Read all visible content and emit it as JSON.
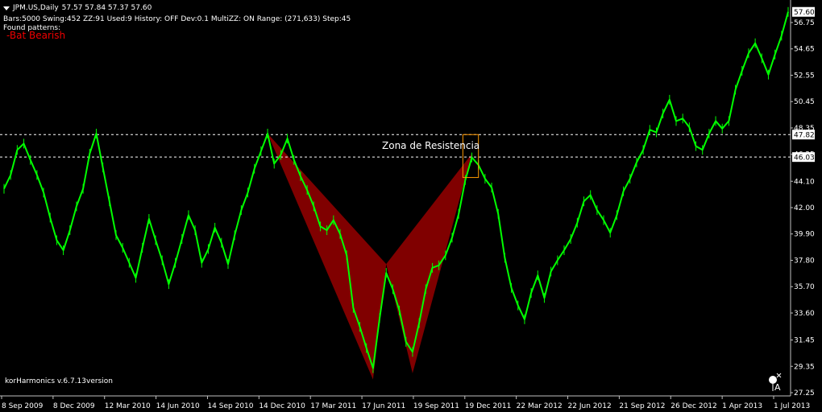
{
  "header": {
    "symbol": "JPM.US,Daily",
    "ohlc": "57.57 57.84 57.37 57.60",
    "info": "Bars:5000  Swing:452  ZZ:91  Used:9  History: OFF Dev:0.1  MultiZZ: ON  Range: (271,633)  Step:45",
    "found_label": "Found patterns:",
    "pattern": "-Bat Bearish"
  },
  "version_label": "korHarmonics v.6.7.13version",
  "colors": {
    "price": "#00ff00",
    "pattern_fill": "#800000",
    "zone_box": "#ff9900",
    "last_price_bg": "#ffffff"
  },
  "chart_data": {
    "type": "line",
    "series": [
      {
        "values": [
          [
            0,
            43.5
          ],
          [
            1,
            44.6
          ],
          [
            2,
            46.6
          ],
          [
            3,
            47.1
          ],
          [
            4,
            45.8
          ],
          [
            5,
            44.6
          ],
          [
            6,
            43.2
          ],
          [
            7,
            41.2
          ],
          [
            8,
            39.4
          ],
          [
            9,
            38.6
          ],
          [
            10,
            40.2
          ],
          [
            11,
            42.1
          ],
          [
            12,
            43.5
          ],
          [
            13,
            46.3
          ],
          [
            14,
            47.9
          ],
          [
            15,
            45.2
          ],
          [
            16,
            42.5
          ],
          [
            17,
            39.8
          ],
          [
            18,
            38.8
          ],
          [
            19,
            37.6
          ],
          [
            20,
            36.4
          ],
          [
            21,
            38.8
          ],
          [
            22,
            41.1
          ],
          [
            23,
            39.4
          ],
          [
            24,
            37.8
          ],
          [
            25,
            35.9
          ],
          [
            26,
            37.6
          ],
          [
            27,
            39.5
          ],
          [
            28,
            41.4
          ],
          [
            29,
            40.2
          ],
          [
            30,
            37.6
          ],
          [
            31,
            38.7
          ],
          [
            32,
            40.4
          ],
          [
            33,
            39.2
          ],
          [
            34,
            37.5
          ],
          [
            35,
            39.8
          ],
          [
            36,
            41.8
          ],
          [
            37,
            43.2
          ],
          [
            38,
            45.1
          ],
          [
            39,
            46.5
          ],
          [
            40,
            47.9
          ],
          [
            41,
            45.5
          ],
          [
            42,
            46.2
          ],
          [
            43,
            47.5
          ],
          [
            44,
            45.8
          ],
          [
            45,
            44.5
          ],
          [
            46,
            43.4
          ],
          [
            47,
            42.1
          ],
          [
            48,
            40.5
          ],
          [
            49,
            40.2
          ],
          [
            50,
            41.0
          ],
          [
            51,
            39.9
          ],
          [
            52,
            38.2
          ],
          [
            53,
            34.0
          ],
          [
            54,
            32.5
          ],
          [
            55,
            30.8
          ],
          [
            56,
            29.2
          ],
          [
            57,
            33.2
          ],
          [
            58,
            36.8
          ],
          [
            59,
            35.5
          ],
          [
            60,
            33.8
          ],
          [
            61,
            31.3
          ],
          [
            62,
            30.5
          ],
          [
            63,
            32.8
          ],
          [
            64,
            35.5
          ],
          [
            65,
            37.2
          ],
          [
            66,
            37.4
          ],
          [
            67,
            38.2
          ],
          [
            68,
            39.6
          ],
          [
            69,
            41.5
          ],
          [
            70,
            44.2
          ],
          [
            71,
            46.0
          ],
          [
            72,
            45.4
          ],
          [
            73,
            44.3
          ],
          [
            74,
            43.6
          ],
          [
            75,
            41.5
          ],
          [
            76,
            38.0
          ],
          [
            77,
            35.6
          ],
          [
            78,
            34.2
          ],
          [
            79,
            33.1
          ],
          [
            80,
            35.2
          ],
          [
            81,
            36.6
          ],
          [
            82,
            34.8
          ],
          [
            83,
            36.9
          ],
          [
            84,
            37.8
          ],
          [
            85,
            38.6
          ],
          [
            86,
            39.5
          ],
          [
            87,
            40.8
          ],
          [
            88,
            42.5
          ],
          [
            89,
            43.0
          ],
          [
            90,
            41.8
          ],
          [
            91,
            41.0
          ],
          [
            92,
            40.0
          ],
          [
            93,
            41.4
          ],
          [
            94,
            43.3
          ],
          [
            95,
            44.3
          ],
          [
            96,
            45.6
          ],
          [
            97,
            46.6
          ],
          [
            98,
            48.2
          ],
          [
            99,
            48.0
          ],
          [
            100,
            49.5
          ],
          [
            101,
            50.6
          ],
          [
            102,
            48.9
          ],
          [
            103,
            49.1
          ],
          [
            104,
            48.4
          ],
          [
            105,
            46.9
          ],
          [
            106,
            46.6
          ],
          [
            107,
            47.9
          ],
          [
            108,
            48.9
          ],
          [
            109,
            48.3
          ],
          [
            110,
            48.9
          ],
          [
            111,
            51.4
          ],
          [
            112,
            52.9
          ],
          [
            113,
            54.3
          ],
          [
            114,
            55.1
          ],
          [
            115,
            53.9
          ],
          [
            116,
            52.6
          ],
          [
            117,
            54.2
          ],
          [
            118,
            55.7
          ],
          [
            119,
            57.6
          ]
        ]
      }
    ],
    "x_ticks": [
      "8 Sep 2009",
      "8 Dec 2009",
      "12 Mar 2010",
      "14 Jun 2010",
      "14 Sep 2010",
      "14 Dec 2010",
      "17 Mar 2011",
      "17 Jun 2011",
      "19 Sep 2011",
      "19 Dec 2011",
      "22 Mar 2012",
      "22 Jun 2012",
      "21 Sep 2012",
      "26 Dec 2012",
      "1 Apr 2013",
      "1 Jul 2013"
    ],
    "y_ticks": [
      "56.75",
      "54.65",
      "52.55",
      "50.45",
      "48.35",
      "46.25",
      "44.10",
      "42.00",
      "39.90",
      "37.80",
      "35.70",
      "33.60",
      "31.45",
      "29.35",
      "27.25"
    ],
    "y_tick_values": [
      56.75,
      54.65,
      52.55,
      50.45,
      48.35,
      46.25,
      44.1,
      42.0,
      39.9,
      37.8,
      35.7,
      33.6,
      31.45,
      29.35,
      27.25
    ],
    "ylim": [
      27.25,
      56.75
    ],
    "last_price": {
      "label": "57.60",
      "value": 57.6
    },
    "levels": [
      {
        "label": "47.82",
        "value": 47.82
      },
      {
        "label": "46.03",
        "value": 46.03
      }
    ],
    "zone_label": "Zona de Resistencia",
    "zone_box": {
      "x0": 70,
      "x1": 72,
      "y0": 44.4,
      "y1": 47.82
    },
    "pattern": {
      "name": "Bat Bearish",
      "X": [
        40,
        47.9
      ],
      "A": [
        56,
        28.3
      ],
      "B": [
        58,
        37.5
      ],
      "C": [
        62,
        28.8
      ],
      "D": [
        71,
        46.3
      ]
    }
  }
}
